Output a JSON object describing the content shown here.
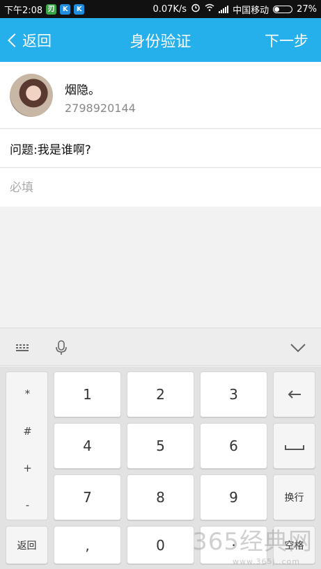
{
  "status_bar": {
    "time": "下午2:08",
    "net_speed": "0.07K/s",
    "carrier": "中国移动",
    "battery": "27%",
    "battery_level": 0.27,
    "app_icons": [
      {
        "glyph": "刃",
        "color": "#3aa54a"
      },
      {
        "glyph": "K",
        "color": "#1f8ee0"
      },
      {
        "glyph": "K",
        "color": "#1f8ee0"
      }
    ]
  },
  "header": {
    "back_label": "返回",
    "title": "身份验证",
    "next_label": "下一步",
    "color": "#25b0ec"
  },
  "profile": {
    "nickname": "烟隐。",
    "account": "2798920144"
  },
  "question": {
    "text": "问题:我是谁啊?"
  },
  "answer": {
    "value": "",
    "placeholder": "必填"
  },
  "keyboard": {
    "symbols": [
      "*",
      "#",
      "+",
      "-"
    ],
    "digits": [
      "1",
      "2",
      "3",
      "4",
      "5",
      "6",
      "7",
      "8",
      "9",
      "0"
    ],
    "back_key": "返回",
    "comma_key": ",",
    "dot_key": "·",
    "newline_key": "换行",
    "space_key": "空格",
    "icons": [
      "keyboard-icon",
      "microphone-icon",
      "chevron-down-icon",
      "backspace-icon",
      "space-icon"
    ]
  },
  "watermark": {
    "text": "365经典网",
    "sub": "www.365j..com"
  }
}
